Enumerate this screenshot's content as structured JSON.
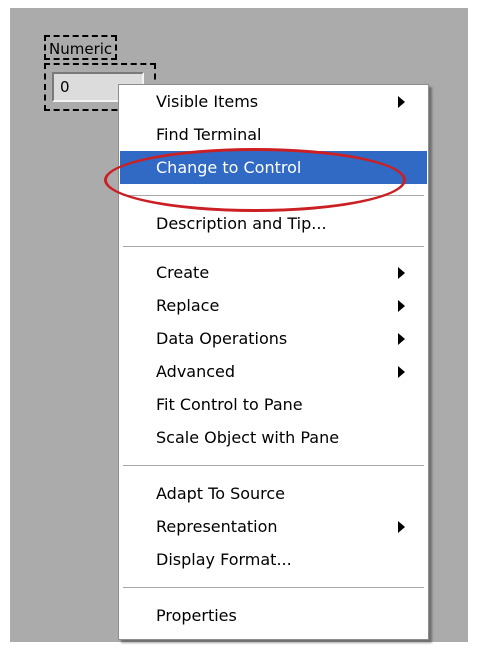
{
  "indicator": {
    "label": "Numeric",
    "value": "0"
  },
  "context_menu": {
    "items": [
      {
        "label": "Visible Items",
        "submenu": true
      },
      {
        "label": "Find Terminal",
        "submenu": false
      },
      {
        "label": "Change to Control",
        "submenu": false,
        "highlighted": true
      },
      {
        "label": "Description and Tip...",
        "submenu": false
      },
      {
        "label": "Create",
        "submenu": true
      },
      {
        "label": "Replace",
        "submenu": true
      },
      {
        "label": "Data Operations",
        "submenu": true
      },
      {
        "label": "Advanced",
        "submenu": true
      },
      {
        "label": "Fit Control to Pane",
        "submenu": false
      },
      {
        "label": "Scale Object with Pane",
        "submenu": false
      },
      {
        "label": "Adapt To Source",
        "submenu": false
      },
      {
        "label": "Representation",
        "submenu": true
      },
      {
        "label": "Display Format...",
        "submenu": false
      },
      {
        "label": "Properties",
        "submenu": false
      }
    ]
  },
  "colors": {
    "panel_background": "#ababab",
    "highlight": "#316ac5",
    "annotation_ellipse": "#cc1f24"
  }
}
